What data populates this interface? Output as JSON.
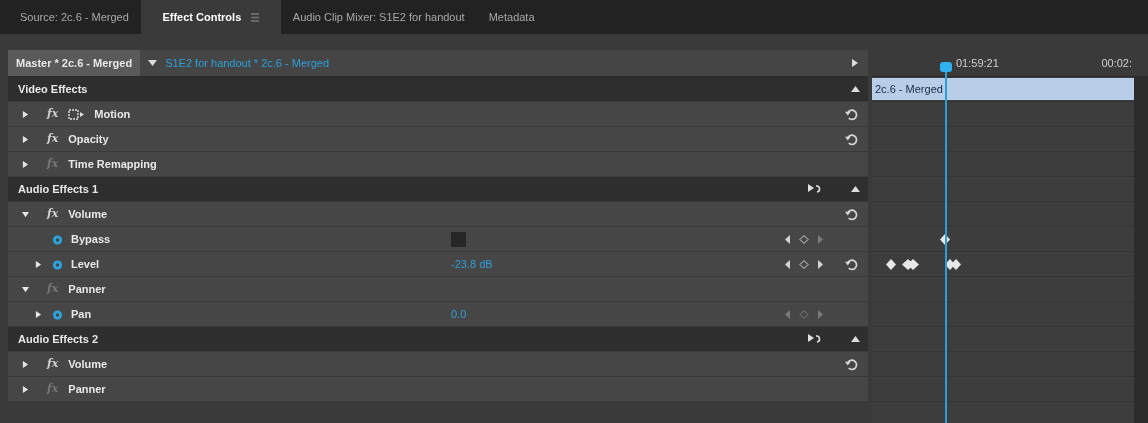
{
  "tabs": [
    {
      "label": "Source: 2c.6 - Merged",
      "selected": false,
      "menu": false
    },
    {
      "label": "Effect Controls",
      "selected": true,
      "menu": true
    },
    {
      "label": "Audio Clip Mixer: S1E2 for handout",
      "selected": false,
      "menu": false
    },
    {
      "label": "Metadata",
      "selected": false,
      "menu": false
    }
  ],
  "header": {
    "master": "Master * 2c.6 - Merged",
    "clip": "S1E2 for handout * 2c.6 - Merged"
  },
  "timeline": {
    "timecodes": [
      "01:59:21",
      "00:02:"
    ],
    "clip_label": "2c.6 - Merged"
  },
  "rows": [
    {
      "kind": "section",
      "label": "Video Effects",
      "route": false
    },
    {
      "kind": "effect",
      "badge": "fx",
      "label": "Motion",
      "expanded": false,
      "enabled": true,
      "transform_icon": true,
      "reset": true
    },
    {
      "kind": "effect",
      "badge": "fx",
      "label": "Opacity",
      "expanded": false,
      "enabled": true,
      "transform_icon": false,
      "reset": true
    },
    {
      "kind": "effect",
      "badge": "fx",
      "label": "Time Remapping",
      "expanded": false,
      "enabled": false,
      "transform_icon": false,
      "reset": false
    },
    {
      "kind": "section",
      "label": "Audio Effects 1",
      "route": true
    },
    {
      "kind": "effect",
      "badge": "fx",
      "label": "Volume",
      "expanded": true,
      "enabled": true,
      "transform_icon": false,
      "reset": true
    },
    {
      "kind": "toggle",
      "label": "Bypass",
      "twirl": false,
      "checked": false,
      "nav_enabled": true,
      "reset": false,
      "keyframed": true
    },
    {
      "kind": "param",
      "label": "Level",
      "twirl": true,
      "value": "-23.8 dB",
      "nav_enabled": true,
      "reset": true,
      "keyframed": true
    },
    {
      "kind": "effect",
      "badge": "fx",
      "label": "Panner",
      "expanded": true,
      "enabled": false,
      "transform_icon": false,
      "reset": false
    },
    {
      "kind": "param",
      "label": "Pan",
      "twirl": true,
      "value": "0.0",
      "nav_enabled": false,
      "reset": false,
      "keyframed": false
    },
    {
      "kind": "section",
      "label": "Audio Effects 2",
      "route": true
    },
    {
      "kind": "effect",
      "badge": "fx",
      "label": "Volume",
      "expanded": false,
      "enabled": true,
      "transform_icon": false,
      "reset": true
    },
    {
      "kind": "effect",
      "badge": "fx",
      "label": "Panner",
      "expanded": false,
      "enabled": false,
      "transform_icon": false,
      "reset": false
    }
  ]
}
